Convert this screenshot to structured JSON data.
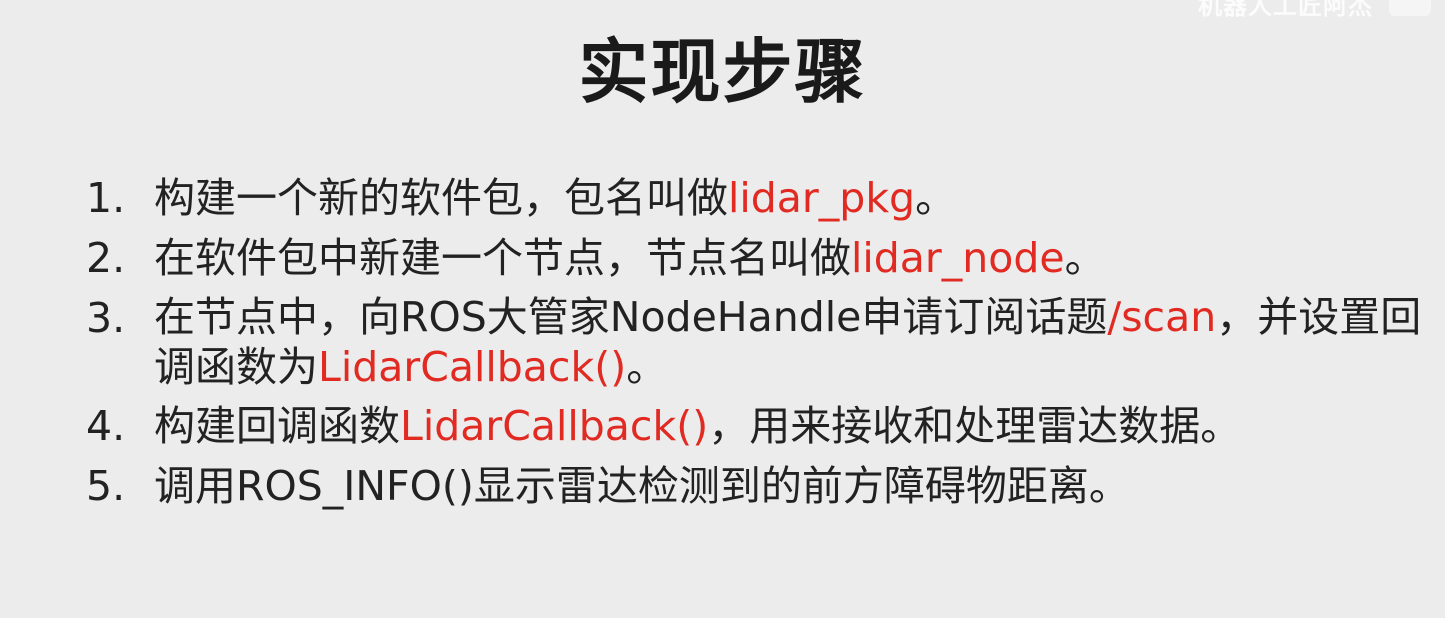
{
  "watermark": "机器人工匠阿杰",
  "title": "实现步骤",
  "steps": [
    {
      "number": "1.",
      "before": "构建一个新的软件包，包名叫做",
      "highlight": "lidar_pkg",
      "after": "。"
    },
    {
      "number": "2.",
      "before": "在软件包中新建一个节点，节点名叫做",
      "highlight": "lidar_node",
      "after": "。"
    },
    {
      "number": "3.",
      "before": "在节点中，向ROS大管家NodeHandle申请订阅话题",
      "highlight": "/scan",
      "middle": "，并设置回调函数为",
      "highlight2": "LidarCallback()",
      "after": "。"
    },
    {
      "number": "4.",
      "before": "构建回调函数",
      "highlight": "LidarCallback()",
      "after": "，用来接收和处理雷达数据。"
    },
    {
      "number": "5.",
      "before": "调用ROS_INFO()显示雷达检测到的前方障碍物距离。"
    }
  ]
}
